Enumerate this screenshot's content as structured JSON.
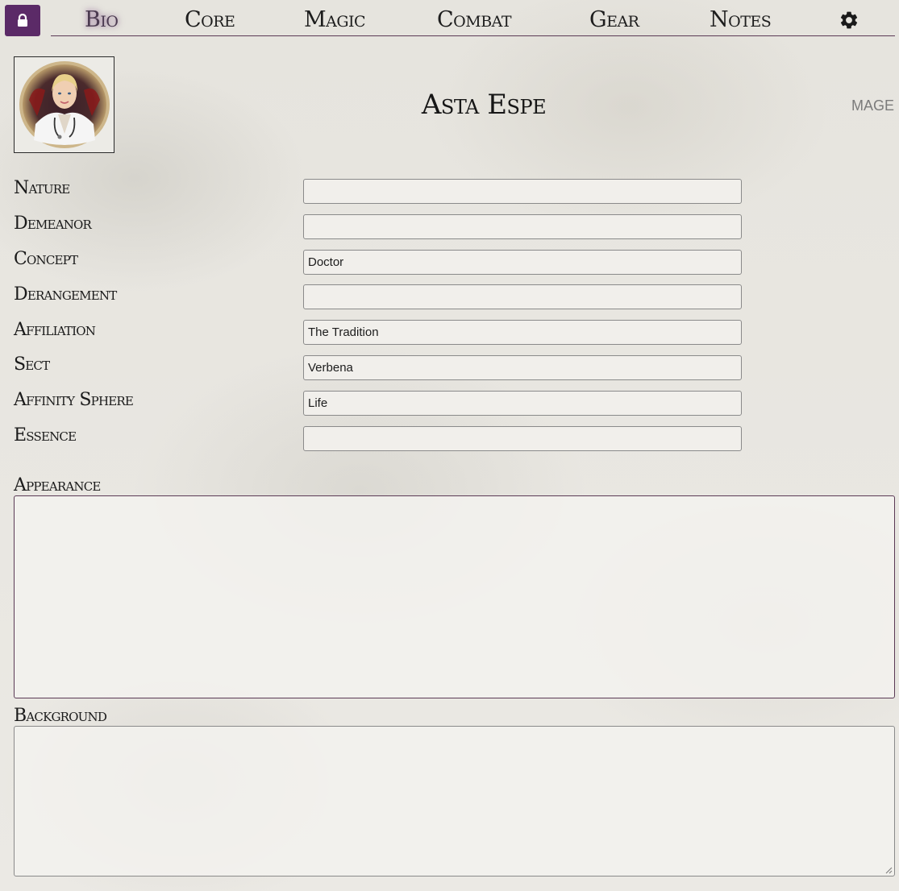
{
  "nav": {
    "tabs": [
      {
        "label": "Bio",
        "active": true
      },
      {
        "label": "Core",
        "active": false
      },
      {
        "label": "Magic",
        "active": false
      },
      {
        "label": "Combat",
        "active": false
      },
      {
        "label": "Gear",
        "active": false
      },
      {
        "label": "Notes",
        "active": false
      }
    ],
    "lock_icon": "lock-icon",
    "settings_icon": "gear-icon"
  },
  "header": {
    "name": "Asta Espe",
    "class": "MAGE",
    "avatar_icon": "character-portrait"
  },
  "fields": [
    {
      "label": "Nature",
      "value": ""
    },
    {
      "label": "Demeanor",
      "value": ""
    },
    {
      "label": "Concept",
      "value": "Doctor"
    },
    {
      "label": "Derangement",
      "value": ""
    },
    {
      "label": "Affiliation",
      "value": "The Tradition"
    },
    {
      "label": "Sect",
      "value": "Verbena"
    },
    {
      "label": "Affinity Sphere",
      "value": "Life"
    },
    {
      "label": "Essence",
      "value": ""
    }
  ],
  "appearance": {
    "label": "Appearance",
    "value": ""
  },
  "background": {
    "label": "Background",
    "value": ""
  },
  "colors": {
    "accent": "#5b2a67",
    "text": "#1a1a1a",
    "muted": "#7b7b7b"
  }
}
